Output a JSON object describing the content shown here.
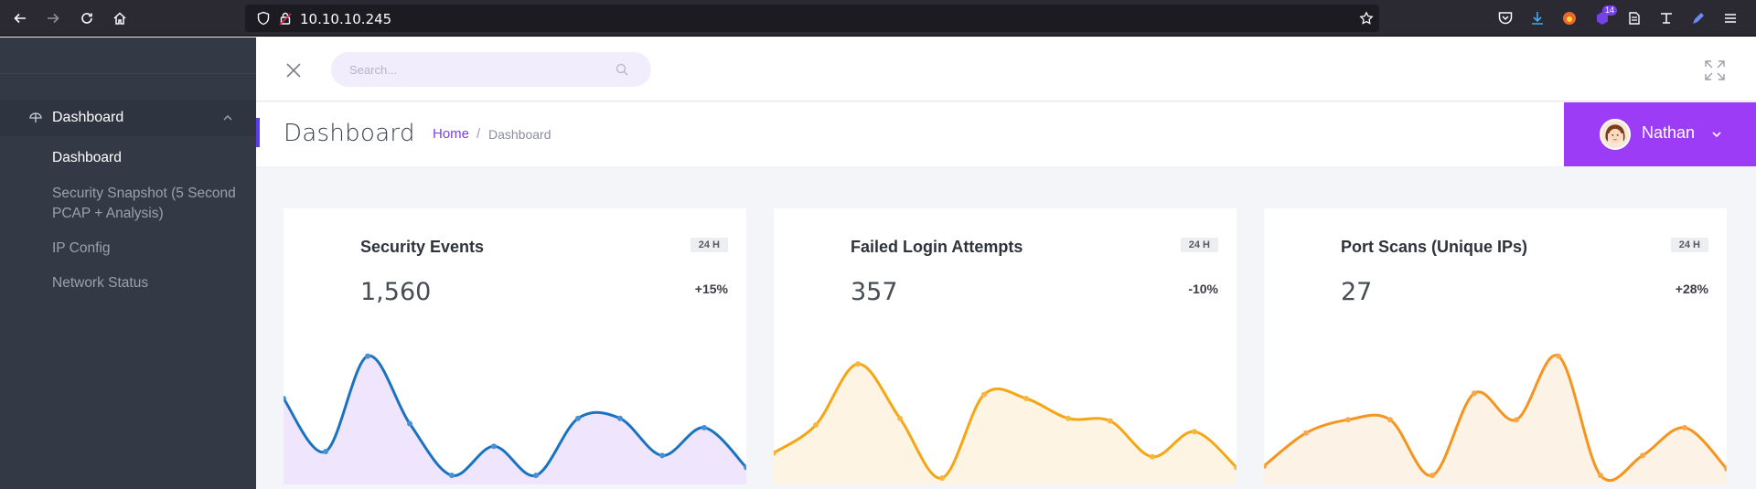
{
  "browser": {
    "url": "10.10.10.245",
    "extension_badge": "14"
  },
  "sidebar": {
    "main_item": {
      "label": "Dashboard"
    },
    "sub_items": [
      {
        "label": "Dashboard"
      },
      {
        "label": "Security Snapshot (5 Second PCAP + Analysis)"
      },
      {
        "label": "IP Config"
      },
      {
        "label": "Network Status"
      }
    ]
  },
  "header": {
    "search_placeholder": "Search..."
  },
  "page": {
    "title": "Dashboard",
    "breadcrumb": {
      "home": "Home",
      "separator": "/",
      "current": "Dashboard"
    }
  },
  "user": {
    "name": "Nathan"
  },
  "colors": {
    "accent": "#5c3ee8",
    "user_button": "#9d3cf7",
    "breadcrumb_link": "#7b3ff2"
  },
  "cards": [
    {
      "title": "Security Events",
      "tag": "24 H",
      "value": "1,560",
      "delta": "+15%",
      "line_color": "#1a73c0",
      "fill_color": "#efe6fd",
      "point_color": "#4a90d9"
    },
    {
      "title": "Failed Login Attempts",
      "tag": "24 H",
      "value": "357",
      "delta": "-10%",
      "line_color": "#f5a614",
      "fill_color": "#fdf4e4",
      "point_color": "#f5b740"
    },
    {
      "title": "Port Scans (Unique IPs)",
      "tag": "24 H",
      "value": "27",
      "delta": "+28%",
      "line_color": "#f5941e",
      "fill_color": "#fdf2e6",
      "point_color": "#f7a84a"
    }
  ],
  "sparklines": [
    [
      6,
      2,
      9.2,
      4.1,
      0.2,
      2.4,
      0.2,
      4.5,
      4.5,
      1.7,
      3.8,
      0.8
    ],
    [
      1.9,
      4,
      8.6,
      4.5,
      0,
      6.3,
      6,
      4.5,
      4.3,
      1.6,
      3.5,
      0.8
    ],
    [
      0.9,
      3.4,
      4.4,
      4.4,
      0.2,
      6.4,
      4.4,
      9.2,
      0.2,
      1.7,
      3.8,
      0.7
    ]
  ]
}
